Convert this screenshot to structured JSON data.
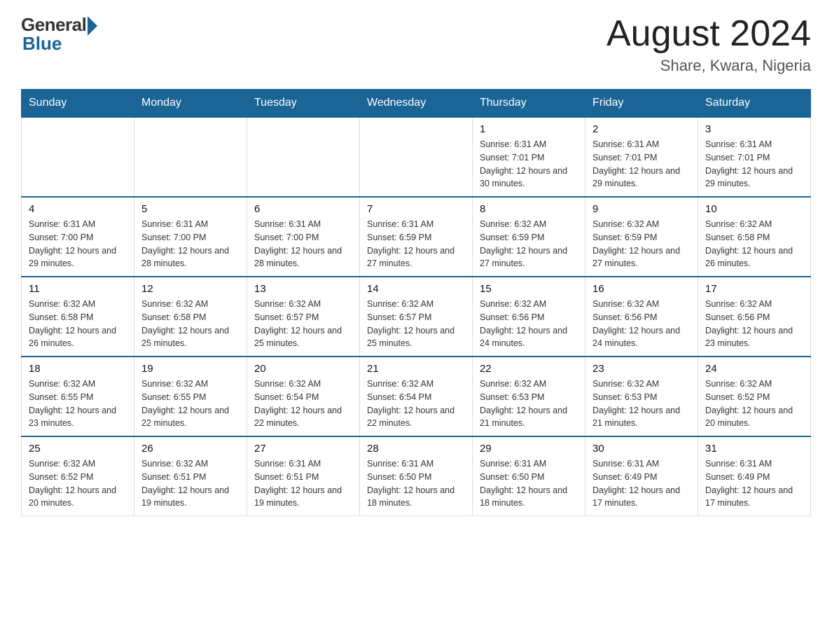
{
  "logo": {
    "general": "General",
    "blue": "Blue"
  },
  "title": {
    "month_year": "August 2024",
    "location": "Share, Kwara, Nigeria"
  },
  "days_of_week": [
    "Sunday",
    "Monday",
    "Tuesday",
    "Wednesday",
    "Thursday",
    "Friday",
    "Saturday"
  ],
  "weeks": [
    [
      {
        "day": "",
        "info": ""
      },
      {
        "day": "",
        "info": ""
      },
      {
        "day": "",
        "info": ""
      },
      {
        "day": "",
        "info": ""
      },
      {
        "day": "1",
        "info": "Sunrise: 6:31 AM\nSunset: 7:01 PM\nDaylight: 12 hours and 30 minutes."
      },
      {
        "day": "2",
        "info": "Sunrise: 6:31 AM\nSunset: 7:01 PM\nDaylight: 12 hours and 29 minutes."
      },
      {
        "day": "3",
        "info": "Sunrise: 6:31 AM\nSunset: 7:01 PM\nDaylight: 12 hours and 29 minutes."
      }
    ],
    [
      {
        "day": "4",
        "info": "Sunrise: 6:31 AM\nSunset: 7:00 PM\nDaylight: 12 hours and 29 minutes."
      },
      {
        "day": "5",
        "info": "Sunrise: 6:31 AM\nSunset: 7:00 PM\nDaylight: 12 hours and 28 minutes."
      },
      {
        "day": "6",
        "info": "Sunrise: 6:31 AM\nSunset: 7:00 PM\nDaylight: 12 hours and 28 minutes."
      },
      {
        "day": "7",
        "info": "Sunrise: 6:31 AM\nSunset: 6:59 PM\nDaylight: 12 hours and 27 minutes."
      },
      {
        "day": "8",
        "info": "Sunrise: 6:32 AM\nSunset: 6:59 PM\nDaylight: 12 hours and 27 minutes."
      },
      {
        "day": "9",
        "info": "Sunrise: 6:32 AM\nSunset: 6:59 PM\nDaylight: 12 hours and 27 minutes."
      },
      {
        "day": "10",
        "info": "Sunrise: 6:32 AM\nSunset: 6:58 PM\nDaylight: 12 hours and 26 minutes."
      }
    ],
    [
      {
        "day": "11",
        "info": "Sunrise: 6:32 AM\nSunset: 6:58 PM\nDaylight: 12 hours and 26 minutes."
      },
      {
        "day": "12",
        "info": "Sunrise: 6:32 AM\nSunset: 6:58 PM\nDaylight: 12 hours and 25 minutes."
      },
      {
        "day": "13",
        "info": "Sunrise: 6:32 AM\nSunset: 6:57 PM\nDaylight: 12 hours and 25 minutes."
      },
      {
        "day": "14",
        "info": "Sunrise: 6:32 AM\nSunset: 6:57 PM\nDaylight: 12 hours and 25 minutes."
      },
      {
        "day": "15",
        "info": "Sunrise: 6:32 AM\nSunset: 6:56 PM\nDaylight: 12 hours and 24 minutes."
      },
      {
        "day": "16",
        "info": "Sunrise: 6:32 AM\nSunset: 6:56 PM\nDaylight: 12 hours and 24 minutes."
      },
      {
        "day": "17",
        "info": "Sunrise: 6:32 AM\nSunset: 6:56 PM\nDaylight: 12 hours and 23 minutes."
      }
    ],
    [
      {
        "day": "18",
        "info": "Sunrise: 6:32 AM\nSunset: 6:55 PM\nDaylight: 12 hours and 23 minutes."
      },
      {
        "day": "19",
        "info": "Sunrise: 6:32 AM\nSunset: 6:55 PM\nDaylight: 12 hours and 22 minutes."
      },
      {
        "day": "20",
        "info": "Sunrise: 6:32 AM\nSunset: 6:54 PM\nDaylight: 12 hours and 22 minutes."
      },
      {
        "day": "21",
        "info": "Sunrise: 6:32 AM\nSunset: 6:54 PM\nDaylight: 12 hours and 22 minutes."
      },
      {
        "day": "22",
        "info": "Sunrise: 6:32 AM\nSunset: 6:53 PM\nDaylight: 12 hours and 21 minutes."
      },
      {
        "day": "23",
        "info": "Sunrise: 6:32 AM\nSunset: 6:53 PM\nDaylight: 12 hours and 21 minutes."
      },
      {
        "day": "24",
        "info": "Sunrise: 6:32 AM\nSunset: 6:52 PM\nDaylight: 12 hours and 20 minutes."
      }
    ],
    [
      {
        "day": "25",
        "info": "Sunrise: 6:32 AM\nSunset: 6:52 PM\nDaylight: 12 hours and 20 minutes."
      },
      {
        "day": "26",
        "info": "Sunrise: 6:32 AM\nSunset: 6:51 PM\nDaylight: 12 hours and 19 minutes."
      },
      {
        "day": "27",
        "info": "Sunrise: 6:31 AM\nSunset: 6:51 PM\nDaylight: 12 hours and 19 minutes."
      },
      {
        "day": "28",
        "info": "Sunrise: 6:31 AM\nSunset: 6:50 PM\nDaylight: 12 hours and 18 minutes."
      },
      {
        "day": "29",
        "info": "Sunrise: 6:31 AM\nSunset: 6:50 PM\nDaylight: 12 hours and 18 minutes."
      },
      {
        "day": "30",
        "info": "Sunrise: 6:31 AM\nSunset: 6:49 PM\nDaylight: 12 hours and 17 minutes."
      },
      {
        "day": "31",
        "info": "Sunrise: 6:31 AM\nSunset: 6:49 PM\nDaylight: 12 hours and 17 minutes."
      }
    ]
  ]
}
